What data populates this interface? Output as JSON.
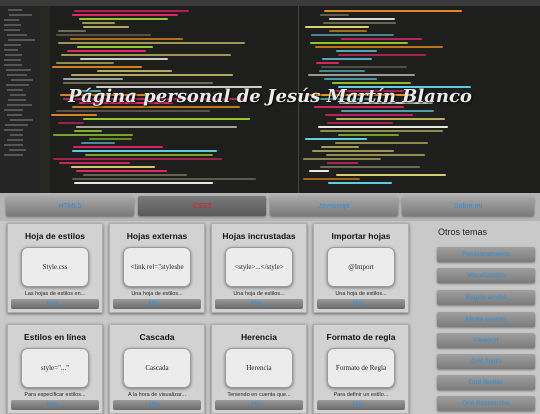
{
  "hero": {
    "title": "Página personal de Jesús Martín Blanco"
  },
  "nav": {
    "items": [
      "HTML5",
      "CSS3",
      "Javascript",
      "Sobre mi"
    ],
    "active_index": 1
  },
  "cards": [
    {
      "title": "Hoja de estilos",
      "inner": "Style.css",
      "desc": "Las hojas de estilos en...",
      "more": "Más..."
    },
    {
      "title": "Hojas externas",
      "inner": "<link rel=\"styleshe",
      "desc": "Una hoja de estilos...",
      "more": "Más..."
    },
    {
      "title": "Hojas incrustadas",
      "inner": "<style>...</style>",
      "desc": "Una hoja de estilos...",
      "more": "Más..."
    },
    {
      "title": "Importar hojas",
      "inner": "@Import",
      "desc": "Una hoja de estilos...",
      "more": "Más..."
    },
    {
      "title": "Estilos en línea",
      "inner": "style=\"...\"",
      "desc": "Para especificar estilos...",
      "more": "Más..."
    },
    {
      "title": "Cascada",
      "inner": "Cascada",
      "desc": "A la hora de visualizar...",
      "more": "Más..."
    },
    {
      "title": "Herencia",
      "inner": "Herencia",
      "desc": "Teniendo en cuenta que...",
      "more": "Más..."
    },
    {
      "title": "Formato de regla",
      "inner": "Formato de Regla",
      "desc": "Para definir un estilo...",
      "more": "Más..."
    }
  ],
  "sidebar": {
    "title": "Otros temas",
    "items": [
      "Posicionamiento",
      "Visualización",
      "Reglas arroba",
      "Media queries",
      "Viewport",
      "Grid fluido",
      "Grid flexible",
      "Grid Responsive"
    ]
  },
  "colors": {
    "link": "#2f8fd8",
    "active": "#e0192b"
  }
}
